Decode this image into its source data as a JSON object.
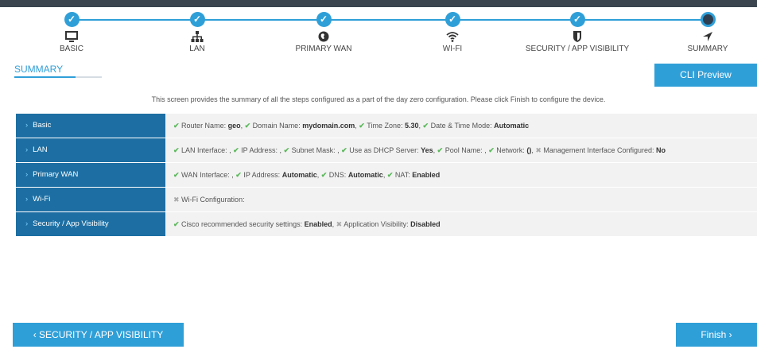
{
  "steps": [
    {
      "label": "BASIC",
      "icon": "monitor-icon",
      "done": true
    },
    {
      "label": "LAN",
      "icon": "network-icon",
      "done": true
    },
    {
      "label": "PRIMARY WAN",
      "icon": "globe-icon",
      "done": true
    },
    {
      "label": "WI-FI",
      "icon": "wifi-icon",
      "done": true
    },
    {
      "label": "SECURITY / APP VISIBILITY",
      "icon": "shield-icon",
      "done": true
    },
    {
      "label": "SUMMARY",
      "icon": "navigation-arrow-icon",
      "done": false
    }
  ],
  "check_glyph": "✓",
  "tab": {
    "label": "SUMMARY"
  },
  "cli_button": "CLI Preview",
  "intro": "This screen provides the summary of all the steps configured as a part of the day zero configuration. Please click Finish to configure the device.",
  "sections": [
    {
      "title": "Basic",
      "items": [
        {
          "ok": true,
          "label": "Router Name:",
          "value": "geo"
        },
        {
          "ok": true,
          "label": "Domain Name:",
          "value": "mydomain.com"
        },
        {
          "ok": true,
          "label": "Time Zone:",
          "value": "5.30"
        },
        {
          "ok": true,
          "label": "Date & Time Mode:",
          "value": "Automatic"
        }
      ]
    },
    {
      "title": "LAN",
      "items": [
        {
          "ok": true,
          "label": "LAN Interface:",
          "value": ""
        },
        {
          "ok": true,
          "label": "IP Address:",
          "value": ""
        },
        {
          "ok": true,
          "label": "Subnet Mask:",
          "value": ""
        },
        {
          "ok": true,
          "label": "Use as DHCP Server:",
          "value": "Yes"
        },
        {
          "ok": true,
          "label": "Pool Name:",
          "value": ""
        },
        {
          "ok": true,
          "label": "Network:",
          "value": "()"
        },
        {
          "ok": false,
          "label": "Management Interface Configured:",
          "value": "No"
        }
      ]
    },
    {
      "title": "Primary WAN",
      "items": [
        {
          "ok": true,
          "label": "WAN Interface:",
          "value": ""
        },
        {
          "ok": true,
          "label": "IP Address:",
          "value": "Automatic"
        },
        {
          "ok": true,
          "label": "DNS:",
          "value": "Automatic"
        },
        {
          "ok": true,
          "label": "NAT:",
          "value": "Enabled"
        }
      ]
    },
    {
      "title": "Wi-Fi",
      "items": [
        {
          "ok": false,
          "label": "Wi-Fi Configuration:",
          "value": ""
        }
      ]
    },
    {
      "title": "Security / App Visibility",
      "items": [
        {
          "ok": true,
          "label": "Cisco recommended security settings:",
          "value": "Enabled"
        },
        {
          "ok": false,
          "label": "Application Visibility:",
          "value": "Disabled"
        }
      ]
    }
  ],
  "back_button": "‹ SECURITY / APP VISIBILITY",
  "finish_button": "Finish ›",
  "colors": {
    "accent": "#2f9fd8",
    "section_header": "#1d6fa3",
    "check": "#5cb85c"
  }
}
